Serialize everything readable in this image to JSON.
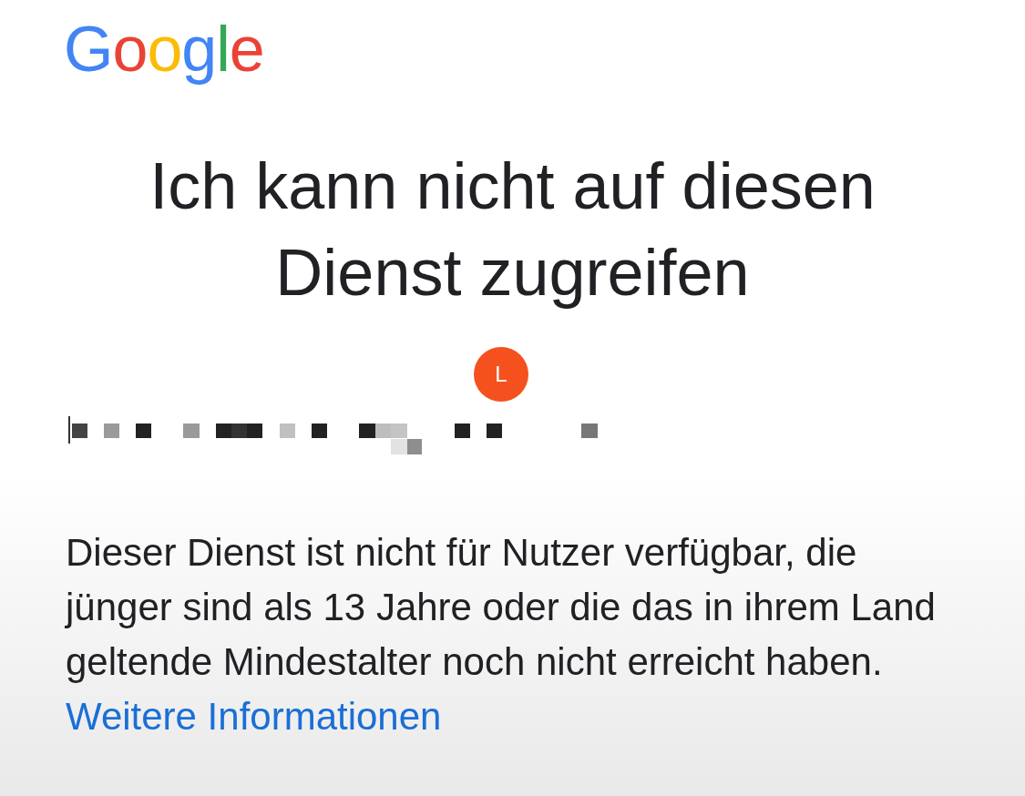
{
  "logo": {
    "text": "Google"
  },
  "title": "Ich kann nicht auf diesen Dienst zugreifen",
  "account": {
    "initial": "L"
  },
  "message": "Dieser Dienst ist nicht für Nutzer verfügbar, die jünger sind als 13 Jahre oder die das in ihrem Land geltende Mindestalter noch nicht erreicht haben.",
  "link": {
    "label": "Weitere Informationen"
  }
}
